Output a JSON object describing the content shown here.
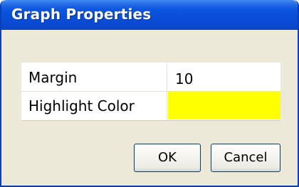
{
  "window": {
    "title": "Graph Properties"
  },
  "properties": [
    {
      "label": "Margin",
      "value": "10"
    },
    {
      "label": "Highlight Color",
      "value": "",
      "color": "#ffff00"
    }
  ],
  "buttons": {
    "ok_label": "OK",
    "cancel_label": "Cancel"
  },
  "colors": {
    "titlebar": "#0a4fd8",
    "dialog_background": "#ece9d8",
    "highlight_color": "#ffff00"
  }
}
